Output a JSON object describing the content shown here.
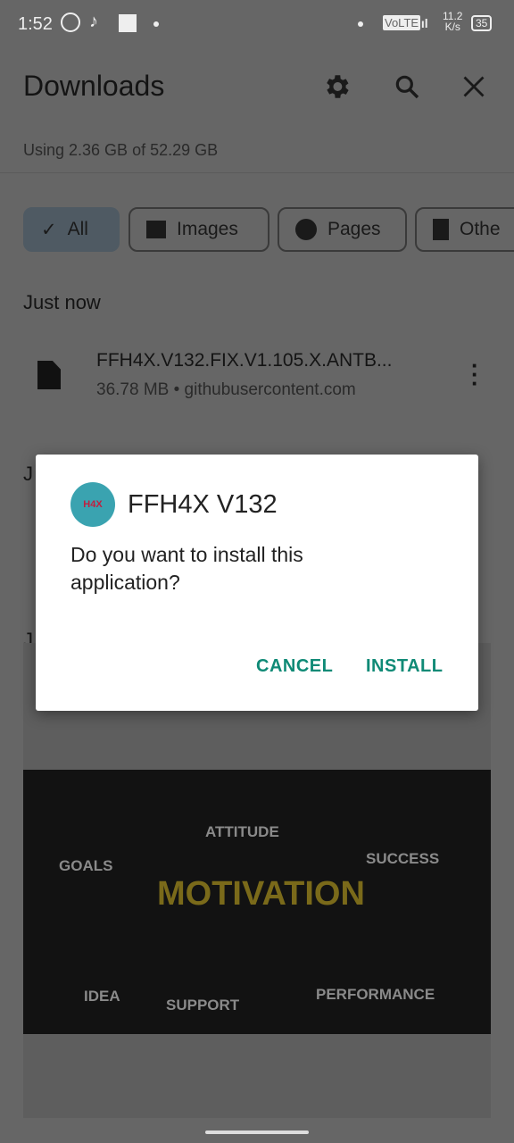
{
  "status_bar": {
    "time": "1:52",
    "network_type": "VoLTE",
    "speed_value": "11.2",
    "speed_unit": "K/s",
    "battery": "35",
    "icons": [
      "whatsapp-icon",
      "tiktok-icon",
      "facebook-icon",
      "dot-icon",
      "signal-icon",
      "battery-icon"
    ]
  },
  "header": {
    "title": "Downloads",
    "icons": [
      "gear-icon",
      "search-icon",
      "close-icon"
    ]
  },
  "storage": {
    "text": "Using 2.36 GB of 52.29 GB"
  },
  "filters": [
    {
      "label": "All",
      "selected": true
    },
    {
      "label": "Images"
    },
    {
      "label": "Pages"
    },
    {
      "label": "Othe"
    }
  ],
  "sections": [
    {
      "title": "Just now",
      "items": [
        {
          "name": "FFH4X.V132.FIX.V1.105.X.ANTB...",
          "meta": "36.78 MB • githubusercontent.com"
        }
      ]
    },
    {
      "title": "J"
    },
    {
      "title": "J"
    }
  ],
  "image_labels": [
    "GOALS",
    "ATTITUDE",
    "SUCCESS",
    "MOTIVATION",
    "IDEA",
    "SUPPORT",
    "PERFORMANCE"
  ],
  "dialog": {
    "app_name": "FFH4X V132",
    "message": "Do you want to install this application?",
    "cancel": "CANCEL",
    "install": "INSTALL",
    "accent": "#0f8a76"
  }
}
